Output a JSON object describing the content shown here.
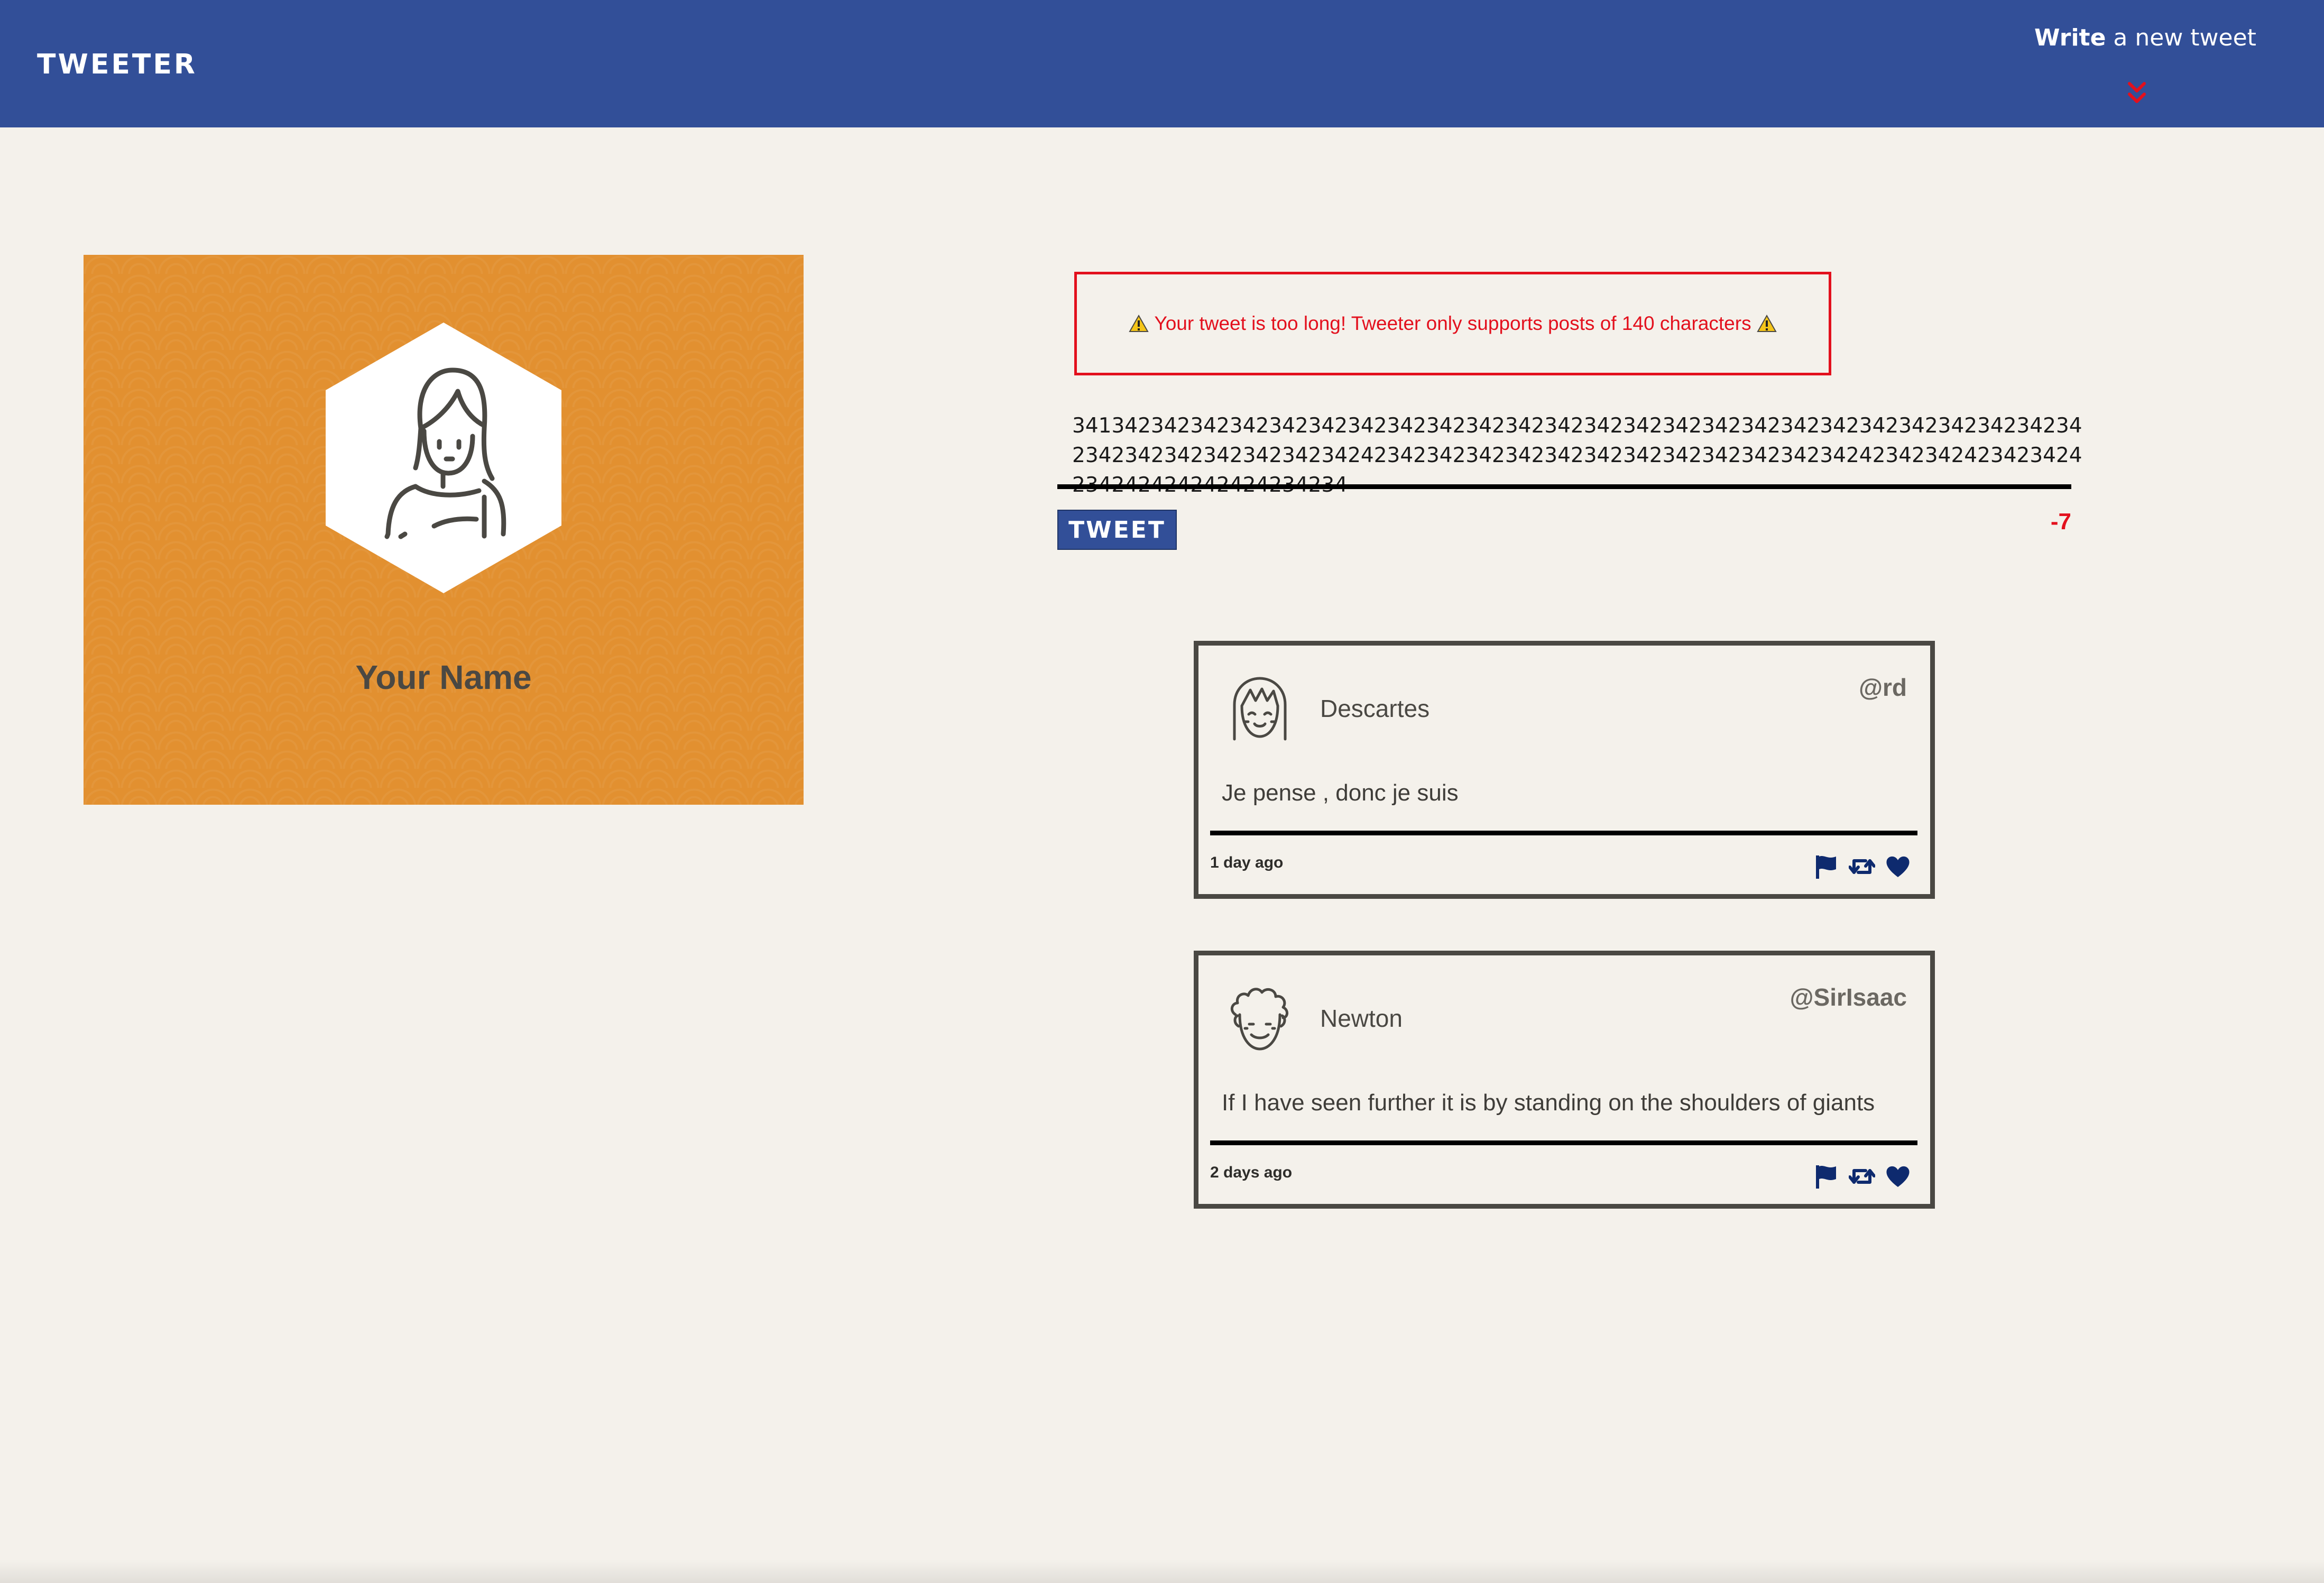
{
  "nav": {
    "brand": "TWEETER",
    "compose_bold": "Write",
    "compose_rest": " a new tweet",
    "arrow_icon": "double-chevron-down-icon",
    "arrow_color": "#e3101d"
  },
  "profile": {
    "name": "Your Name",
    "background_color": "#e29030"
  },
  "compose": {
    "error_message": "Your tweet is too long! Tweeter only supports posts of 140 characters",
    "warning_icon": "warning-icon",
    "text_value": "3413423423423423423423423423423423423423423423423423423423423423423423423423423423423423423423423424234234234234234234234234234234234234242342342423423424234242424242424234234",
    "submit_label": "TWEET",
    "counter": "-7"
  },
  "tweets": [
    {
      "name": "Descartes",
      "handle": "@rd",
      "content": "Je pense , donc je suis",
      "time": "1 day ago",
      "avatar_icon": "girl-face-avatar-icon"
    },
    {
      "name": "Newton",
      "handle": "@SirIsaac",
      "content": "If I have seen further it is by standing on the shoulders of giants",
      "time": "2 days ago",
      "avatar_icon": "curly-hair-avatar-icon"
    }
  ],
  "colors": {
    "nav": "#324f98",
    "background": "#f4f1eb",
    "error": "#e3101d",
    "action_icons": "#0e2a6e"
  }
}
